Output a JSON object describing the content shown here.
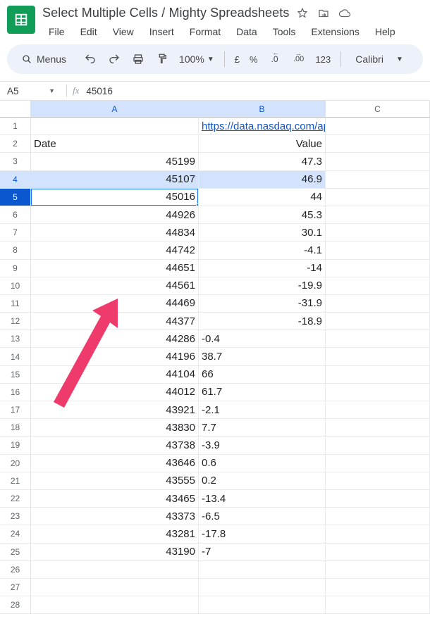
{
  "doc": {
    "title": "Select Multiple Cells / Mighty Spreadsheets"
  },
  "menus": [
    "File",
    "Edit",
    "View",
    "Insert",
    "Format",
    "Data",
    "Tools",
    "Extensions",
    "Help"
  ],
  "toolbar": {
    "menus_label": "Menus",
    "zoom": "100%",
    "currency": "£",
    "percent": "%",
    "dec_dec": ".0",
    "inc_dec": ".00",
    "numfmt": "123",
    "font": "Calibri"
  },
  "namebox": {
    "ref": "A5",
    "formula": "45016"
  },
  "columns": [
    "A",
    "B",
    "C"
  ],
  "selection": {
    "prevRow": 4,
    "activeRow": 5,
    "activeCol": "A",
    "selCols": [
      "A",
      "B"
    ]
  },
  "link": {
    "text": "https://data.nasdaq.com/ap"
  },
  "headers": {
    "a": "Date",
    "b": "Value"
  },
  "rows": [
    {
      "n": 1
    },
    {
      "n": 2
    },
    {
      "n": 3,
      "a": "45199",
      "b": "47.3",
      "bAlign": "right"
    },
    {
      "n": 4,
      "a": "45107",
      "b": "46.9",
      "bAlign": "right"
    },
    {
      "n": 5,
      "a": "45016",
      "b": "44",
      "bAlign": "right"
    },
    {
      "n": 6,
      "a": "44926",
      "b": "45.3",
      "bAlign": "right"
    },
    {
      "n": 7,
      "a": "44834",
      "b": "30.1",
      "bAlign": "right"
    },
    {
      "n": 8,
      "a": "44742",
      "b": "-4.1",
      "bAlign": "right"
    },
    {
      "n": 9,
      "a": "44651",
      "b": "-14",
      "bAlign": "right"
    },
    {
      "n": 10,
      "a": "44561",
      "b": "-19.9",
      "bAlign": "right"
    },
    {
      "n": 11,
      "a": "44469",
      "b": "-31.9",
      "bAlign": "right"
    },
    {
      "n": 12,
      "a": "44377",
      "b": "-18.9",
      "bAlign": "right"
    },
    {
      "n": 13,
      "a": "44286",
      "b": "-0.4",
      "bAlign": "left"
    },
    {
      "n": 14,
      "a": "44196",
      "b": "38.7",
      "bAlign": "left"
    },
    {
      "n": 15,
      "a": "44104",
      "b": "66",
      "bAlign": "left"
    },
    {
      "n": 16,
      "a": "44012",
      "b": "61.7",
      "bAlign": "left"
    },
    {
      "n": 17,
      "a": "43921",
      "b": "-2.1",
      "bAlign": "left"
    },
    {
      "n": 18,
      "a": "43830",
      "b": "7.7",
      "bAlign": "left"
    },
    {
      "n": 19,
      "a": "43738",
      "b": "-3.9",
      "bAlign": "left"
    },
    {
      "n": 20,
      "a": "43646",
      "b": "0.6",
      "bAlign": "left"
    },
    {
      "n": 21,
      "a": "43555",
      "b": "0.2",
      "bAlign": "left"
    },
    {
      "n": 22,
      "a": "43465",
      "b": "-13.4",
      "bAlign": "left"
    },
    {
      "n": 23,
      "a": "43373",
      "b": "-6.5",
      "bAlign": "left"
    },
    {
      "n": 24,
      "a": "43281",
      "b": "-17.8",
      "bAlign": "left"
    },
    {
      "n": 25,
      "a": "43190",
      "b": "-7",
      "bAlign": "left"
    },
    {
      "n": 26
    },
    {
      "n": 27
    },
    {
      "n": 28
    }
  ],
  "chart_data": {
    "type": "table",
    "columns": [
      "Date",
      "Value"
    ],
    "data": [
      [
        45199,
        47.3
      ],
      [
        45107,
        46.9
      ],
      [
        45016,
        44
      ],
      [
        44926,
        45.3
      ],
      [
        44834,
        30.1
      ],
      [
        44742,
        -4.1
      ],
      [
        44651,
        -14
      ],
      [
        44561,
        -19.9
      ],
      [
        44469,
        -31.9
      ],
      [
        44377,
        -18.9
      ],
      [
        44286,
        -0.4
      ],
      [
        44196,
        38.7
      ],
      [
        44104,
        66
      ],
      [
        44012,
        61.7
      ],
      [
        43921,
        -2.1
      ],
      [
        43830,
        7.7
      ],
      [
        43738,
        -3.9
      ],
      [
        43646,
        0.6
      ],
      [
        43555,
        0.2
      ],
      [
        43465,
        -13.4
      ],
      [
        43373,
        -6.5
      ],
      [
        43281,
        -17.8
      ],
      [
        43190,
        -7
      ]
    ]
  }
}
